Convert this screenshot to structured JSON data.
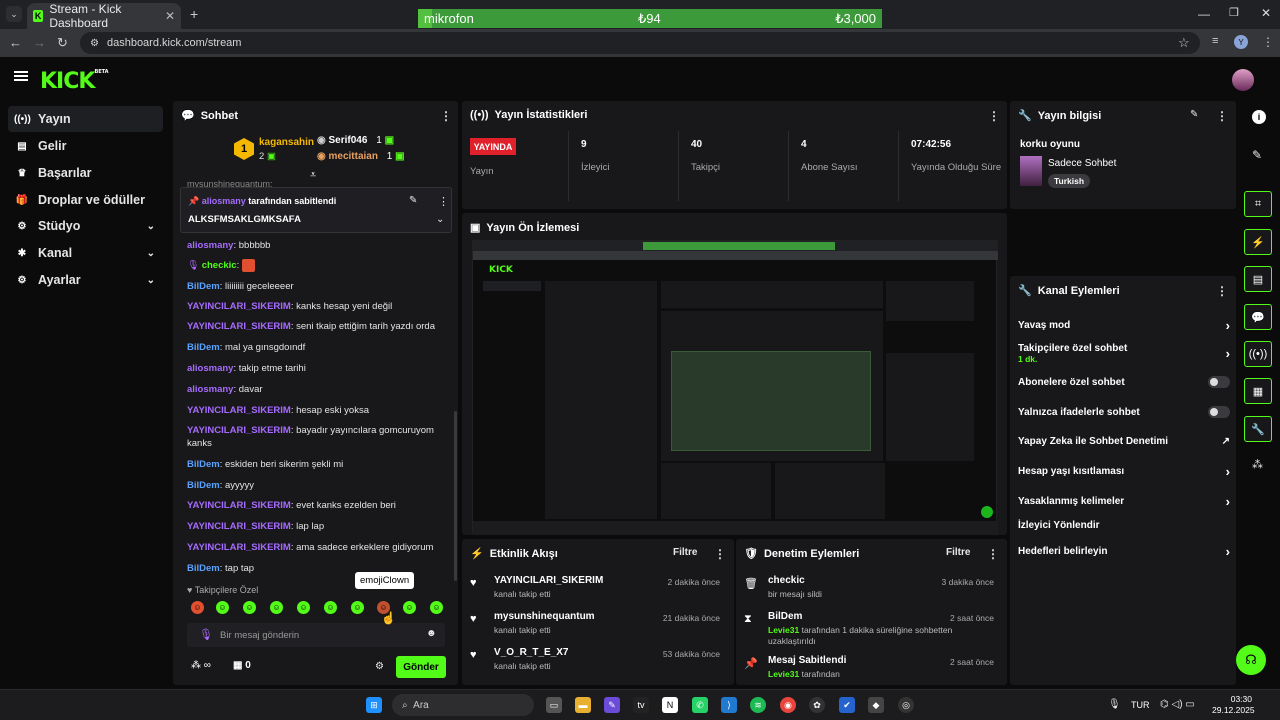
{
  "browser": {
    "tab_title": "Stream - Kick Dashboard",
    "url": "dashboard.kick.com/stream",
    "banner": {
      "label": "mikrofon",
      "current": "₺94",
      "goal": "₺3,000",
      "progress": 0.031
    }
  },
  "app": {
    "logo": "KICK",
    "logo_badge": "BETA"
  },
  "nav": [
    {
      "label": "Yayın",
      "icon": "broadcast-icon",
      "active": true
    },
    {
      "label": "Gelir",
      "icon": "money-icon"
    },
    {
      "label": "Başarılar",
      "icon": "trophy-icon"
    },
    {
      "label": "Droplar ve ödüller",
      "icon": "gift-icon"
    },
    {
      "label": "Stüdyo",
      "icon": "studio-icon",
      "expandable": true
    },
    {
      "label": "Kanal",
      "icon": "channel-icon",
      "expandable": true
    },
    {
      "label": "Ayarlar",
      "icon": "gear-icon",
      "expandable": true
    }
  ],
  "chat": {
    "title": "Sohbet",
    "leaders": [
      {
        "rank": "1",
        "name": "kagansahin",
        "count": "2"
      },
      {
        "name": "Serif046",
        "count": "1"
      },
      {
        "name": "mecittaian",
        "count": "1"
      }
    ],
    "partial_top": "mysunshinequantum:",
    "pinned": {
      "by_user": "aliosmany",
      "by_suffix": "tarafından sabitlendi",
      "text": "ALKSFMSAKLGMKSAFA"
    },
    "messages": [
      {
        "user": "aliosmany",
        "color": "purple",
        "text": "bbbbbb"
      },
      {
        "user": "checkic",
        "color": "green",
        "text": "",
        "emote": true
      },
      {
        "user": "BilDem",
        "color": "blue",
        "text": "liiiiiiii geceleeeer"
      },
      {
        "user": "YAYINCILARI_SIKERIM",
        "color": "purple",
        "text": "kanks hesap yeni değil"
      },
      {
        "user": "YAYINCILARI_SIKERIM",
        "color": "purple",
        "text": "seni tkaip ettiğim tarih yazdı orda"
      },
      {
        "user": "BilDem",
        "color": "blue",
        "text": "mal ya gınsgdoındf"
      },
      {
        "user": "aliosmany",
        "color": "purple",
        "text": "takip etme tarihi"
      },
      {
        "user": "aliosmany",
        "color": "purple",
        "text": "davar"
      },
      {
        "user": "YAYINCILARI_SIKERIM",
        "color": "purple",
        "text": "hesap eski yoksa"
      },
      {
        "user": "YAYINCILARI_SIKERIM",
        "color": "purple",
        "text": "bayadır yayıncılara gomcuruyom kanks"
      },
      {
        "user": "BilDem",
        "color": "blue",
        "text": "eskiden beri sikerim şekli mi"
      },
      {
        "user": "BilDem",
        "color": "blue",
        "text": "ayyyyy"
      },
      {
        "user": "YAYINCILARI_SIKERIM",
        "color": "purple",
        "text": "evet kanks ezelden beri"
      },
      {
        "user": "YAYINCILARI_SIKERIM",
        "color": "purple",
        "text": "lap lap"
      },
      {
        "user": "YAYINCILARI_SIKERIM",
        "color": "purple",
        "text": "ama sadece erkeklere gidiyorum"
      },
      {
        "user": "BilDem",
        "color": "blue",
        "text": "tap tap"
      }
    ],
    "emote_tooltip": "emojiClown",
    "emote_section": "Takipçilere Özel",
    "input_placeholder": "Bir mesaj gönderin",
    "send_label": "Gönder",
    "footer_count": "0"
  },
  "stats": {
    "title": "Yayın İstatistikleri",
    "live_badge": "YAYINDA",
    "live_label": "Yayın",
    "items": [
      {
        "value": "9",
        "label": "İzleyici"
      },
      {
        "value": "40",
        "label": "Takipçi"
      },
      {
        "value": "4",
        "label": "Abone Sayısı"
      },
      {
        "value": "07:42:56",
        "label": "Yayında Olduğu Süre"
      }
    ]
  },
  "preview": {
    "title": "Yayın Ön İzlemesi"
  },
  "stream_info": {
    "title": "Yayın bilgisi",
    "stream_title": "korku oyunu",
    "category": "Sadece Sohbet",
    "tag": "Turkish"
  },
  "channel_actions": {
    "title": "Kanal Eylemleri",
    "items": [
      {
        "label": "Yavaş mod",
        "control": "arrow"
      },
      {
        "label": "Takipçilere özel sohbet",
        "sub": "1 dk.",
        "control": "arrow"
      },
      {
        "label": "Abonelere özel sohbet",
        "control": "toggle"
      },
      {
        "label": "Yalnızca ifadelerle sohbet",
        "control": "toggle"
      },
      {
        "label": "Yapay Zeka ile Sohbet Denetimi",
        "control": "external"
      },
      {
        "label": "Hesap yaşı kısıtlaması",
        "control": "arrow"
      },
      {
        "label": "Yasaklanmış kelimeler",
        "control": "arrow"
      },
      {
        "label": "İzleyici Yönlendir",
        "control": "none"
      },
      {
        "label": "Hedefleri belirleyin",
        "control": "arrow"
      }
    ]
  },
  "activity": {
    "title": "Etkinlik Akışı",
    "filter": "Filtre",
    "items": [
      {
        "user": "YAYINCILARI_SIKERIM",
        "desc": "kanalı takip etti",
        "time": "2 dakika önce"
      },
      {
        "user": "mysunshinequantum",
        "desc": "kanalı takip etti",
        "time": "21 dakika önce"
      },
      {
        "user": "V_O_R_T_E_X7",
        "desc": "kanalı takip etti",
        "time": "53 dakika önce"
      }
    ]
  },
  "moderation": {
    "title": "Denetim Eylemleri",
    "filter": "Filtre",
    "items": [
      {
        "user": "checkic",
        "desc": "bir mesajı sildi",
        "time": "3 dakika önce",
        "icon": "trash-icon"
      },
      {
        "user": "BilDem",
        "actor": "Levie31",
        "desc": "tarafından 1 dakika süreliğine sohbetten uzaklaştırıldı",
        "time": "2 saat önce",
        "icon": "hourglass-icon"
      },
      {
        "user": "Mesaj Sabitlendi",
        "actor": "Levie31",
        "desc": "tarafından",
        "time": "2 saat önce",
        "icon": "pin-icon"
      }
    ]
  },
  "taskbar": {
    "search": "Ara",
    "lang": "TUR",
    "time": "03:30",
    "date": "29.12.2025"
  },
  "colors": {
    "accent": "#53fc18",
    "panel": "#18181b",
    "live": "#e0202a",
    "purple": "#a56bfd",
    "blue": "#5aa3ff"
  }
}
